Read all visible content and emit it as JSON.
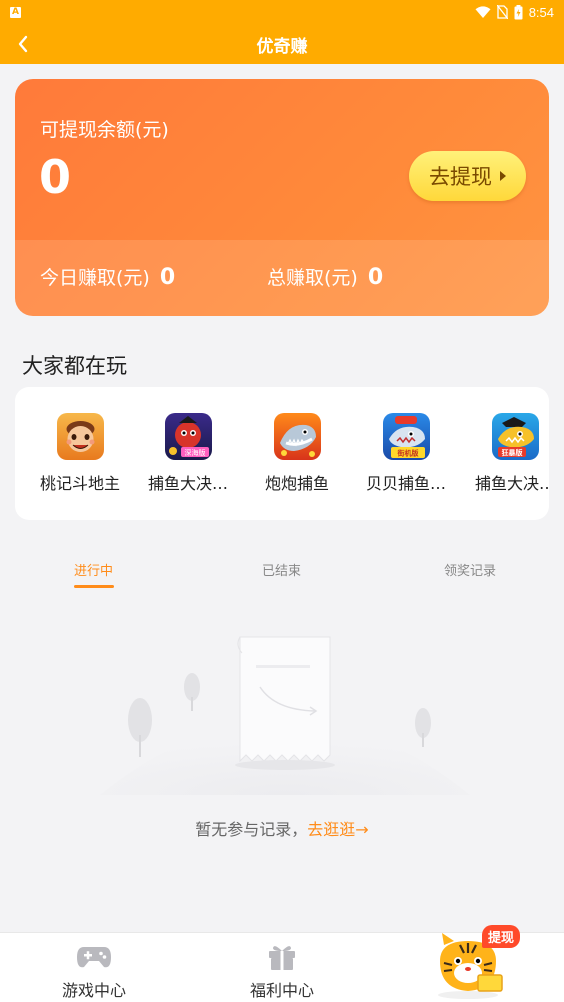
{
  "status_bar": {
    "time": "8:54",
    "app_indicator": "A"
  },
  "header": {
    "title": "优奇赚"
  },
  "balance": {
    "label": "可提现余额(元)",
    "value": "0",
    "withdraw_label": "去提现",
    "today_label": "今日赚取(元)",
    "today_value": "0",
    "total_label": "总赚取(元)",
    "total_value": "0"
  },
  "section": {
    "title": "大家都在玩"
  },
  "games": [
    {
      "name": "桃记斗地主",
      "icon": "doudizhu-icon"
    },
    {
      "name": "捕鱼大决…",
      "icon": "fishing-icon",
      "badge": "深海版"
    },
    {
      "name": "炮炮捕鱼",
      "icon": "shark-icon"
    },
    {
      "name": "贝贝捕鱼…",
      "icon": "fishing-icon",
      "badge": "街机版"
    },
    {
      "name": "捕鱼大决…",
      "icon": "fishing-icon",
      "badge": "狂暴版"
    }
  ],
  "tabs": [
    {
      "label": "进行中",
      "active": true
    },
    {
      "label": "已结束",
      "active": false
    },
    {
      "label": "领奖记录",
      "active": false
    }
  ],
  "empty_state": {
    "text": "暂无参与记录，",
    "link": "去逛逛→"
  },
  "bottom_nav": {
    "items": [
      {
        "label": "游戏中心",
        "icon": "gamepad-icon"
      },
      {
        "label": "福利中心",
        "icon": "gift-icon"
      }
    ],
    "withdraw_badge": "提现"
  },
  "colors": {
    "accent": "#ffab00",
    "card": "#ff8a3a",
    "link": "#ff8c1a"
  }
}
